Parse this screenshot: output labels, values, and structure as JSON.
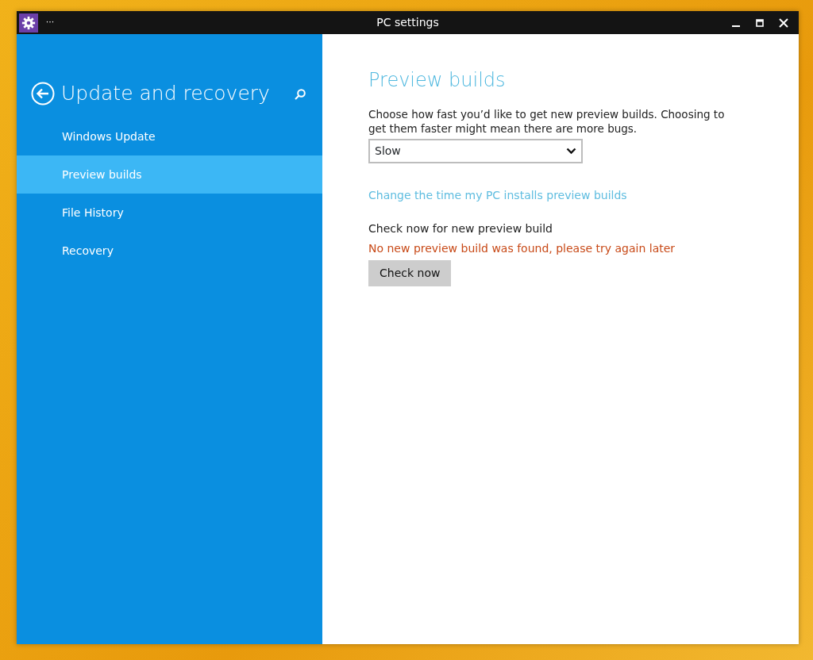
{
  "window": {
    "title": "PC settings",
    "menu_glyph": "···"
  },
  "sidebar": {
    "heading": "Update and recovery",
    "items": [
      {
        "label": "Windows Update",
        "selected": false
      },
      {
        "label": "Preview builds",
        "selected": true
      },
      {
        "label": "File History",
        "selected": false
      },
      {
        "label": "Recovery",
        "selected": false
      }
    ]
  },
  "content": {
    "title": "Preview builds",
    "description": "Choose how fast you’d like to get new preview builds. Choosing to get them faster might mean there are more bugs.",
    "speed_dropdown": {
      "value": "Slow"
    },
    "link": "Change the time my PC installs preview builds",
    "check_label": "Check now for new preview build",
    "status": {
      "text": "No new preview build was found, please try again later",
      "kind": "error"
    },
    "button": "Check now"
  }
}
